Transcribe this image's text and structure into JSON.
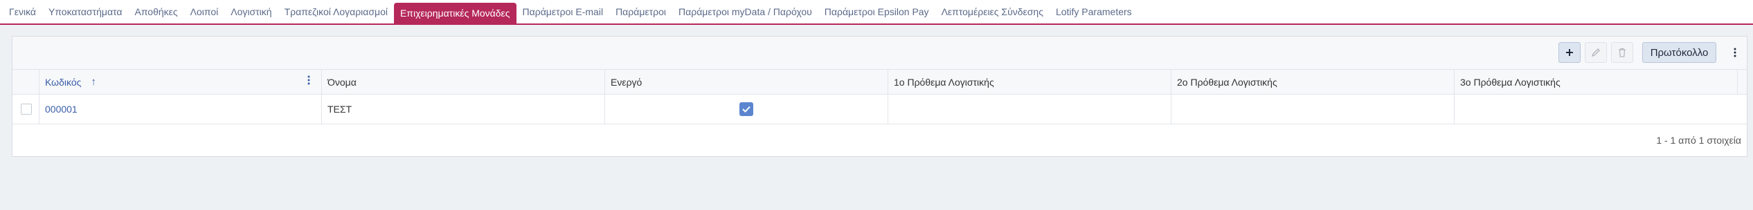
{
  "tabs": [
    {
      "label": "Γενικά"
    },
    {
      "label": "Υποκαταστήματα"
    },
    {
      "label": "Αποθήκες"
    },
    {
      "label": "Λοιποί"
    },
    {
      "label": "Λογιστική"
    },
    {
      "label": "Τραπεζικοί Λογαριασμοί"
    },
    {
      "label": "Επιχειρηματικές Μονάδες",
      "active": true
    },
    {
      "label": "Παράμετροι E-mail"
    },
    {
      "label": "Παράμετροι"
    },
    {
      "label": "Παράμετροι myData / Παρόχου"
    },
    {
      "label": "Παράμετροι Epsilon Pay"
    },
    {
      "label": "Λεπτομέρειες Σύνδεσης"
    },
    {
      "label": "Lotify Parameters"
    }
  ],
  "toolbar": {
    "add_icon": "plus-icon",
    "edit_icon": "pencil-icon",
    "delete_icon": "trash-icon",
    "protocol_label": "Πρωτόκολλο",
    "more_icon": "kebab-icon"
  },
  "table": {
    "columns": [
      {
        "label": "Κωδικός",
        "sorted": "asc"
      },
      {
        "label": "Όνομα"
      },
      {
        "label": "Ενεργό"
      },
      {
        "label": "1ο Πρόθεμα Λογιστικής"
      },
      {
        "label": "2ο Πρόθεμα Λογιστικής"
      },
      {
        "label": "3ο Πρόθεμα Λογιστικής"
      }
    ],
    "rows": [
      {
        "code": "000001",
        "name": "ΤΕΣΤ",
        "active": true,
        "prefix1": "",
        "prefix2": "",
        "prefix3": ""
      }
    ],
    "pagination": "1 - 1 από 1 στοιχεία"
  },
  "colors": {
    "accent": "#b5285a",
    "link": "#3a5da8",
    "checkbox": "#5b86cf"
  }
}
